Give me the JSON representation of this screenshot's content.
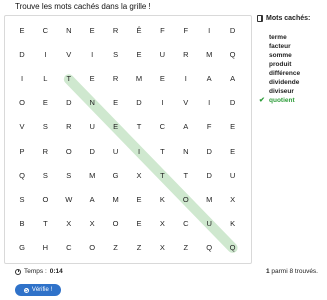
{
  "title": "Trouve les mots cachés dans la grille !",
  "grid": [
    [
      "E",
      "C",
      "N",
      "E",
      "R",
      "Ê",
      "F",
      "F",
      "I",
      "D"
    ],
    [
      "D",
      "I",
      "V",
      "I",
      "S",
      "E",
      "U",
      "R",
      "M",
      "Q"
    ],
    [
      "I",
      "L",
      "T",
      "E",
      "R",
      "M",
      "E",
      "I",
      "A",
      "A"
    ],
    [
      "O",
      "E",
      "D",
      "N",
      "E",
      "D",
      "I",
      "V",
      "I",
      "D"
    ],
    [
      "V",
      "S",
      "R",
      "U",
      "E",
      "T",
      "C",
      "A",
      "F",
      "E"
    ],
    [
      "P",
      "R",
      "O",
      "D",
      "U",
      "I",
      "T",
      "N",
      "D",
      "E"
    ],
    [
      "Q",
      "S",
      "S",
      "M",
      "G",
      "X",
      "T",
      "T",
      "D",
      "U"
    ],
    [
      "S",
      "O",
      "W",
      "A",
      "M",
      "E",
      "K",
      "O",
      "M",
      "X"
    ],
    [
      "B",
      "T",
      "X",
      "X",
      "O",
      "E",
      "X",
      "C",
      "U",
      "K"
    ],
    [
      "G",
      "H",
      "C",
      "O",
      "Z",
      "Z",
      "X",
      "Z",
      "Q",
      "Q"
    ]
  ],
  "found_highlight": {
    "word": "quotient",
    "start": [
      2,
      2
    ],
    "end": [
      9,
      9
    ],
    "color": "#cfe8cf"
  },
  "sidebar": {
    "heading": "Mots cachés:",
    "words": [
      {
        "text": "terme",
        "found": false
      },
      {
        "text": "facteur",
        "found": false
      },
      {
        "text": "somme",
        "found": false
      },
      {
        "text": "produit",
        "found": false
      },
      {
        "text": "différence",
        "found": false
      },
      {
        "text": "dividende",
        "found": false
      },
      {
        "text": "diviseur",
        "found": false
      },
      {
        "text": "quotient",
        "found": true
      }
    ]
  },
  "footer": {
    "time_label": "Temps :",
    "time_value": "0:14",
    "found_count": "1",
    "found_text": "parmi 8 trouvés."
  },
  "button": {
    "label": "Vérifie !"
  }
}
